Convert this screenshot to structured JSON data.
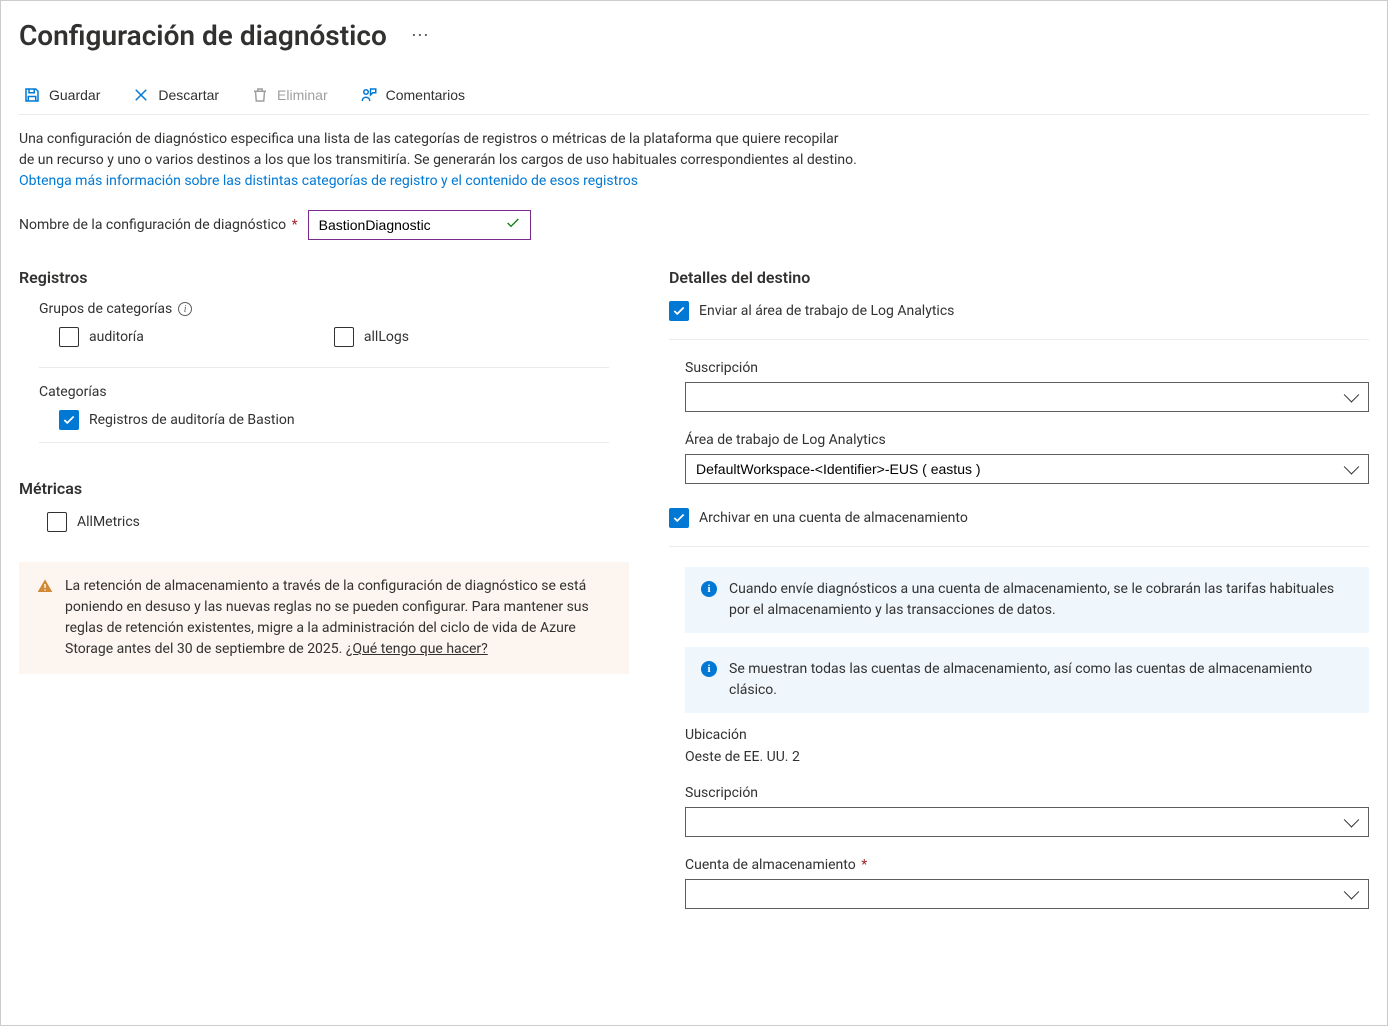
{
  "page_title": "Configuración de diagnóstico",
  "toolbar": {
    "save": "Guardar",
    "discard": "Descartar",
    "delete": "Eliminar",
    "comments": "Comentarios"
  },
  "description": {
    "line1": "Una configuración de diagnóstico especifica una lista de las categorías de registros o métricas de la plataforma que quiere recopilar",
    "line2": "de un recurso y uno o varios destinos a los que los transmitiría. Se generarán los cargos de uso habituales correspondientes al destino.",
    "link": "Obtenga más información sobre las distintas categorías de registro y el contenido de esos registros"
  },
  "name_field": {
    "label": "Nombre de la configuración de diagnóstico",
    "value": "BastionDiagnostic"
  },
  "logs": {
    "title": "Registros",
    "category_groups_title": "Grupos de categorías",
    "auditoria": "auditoría",
    "allLogs": "allLogs",
    "categories_title": "Categorías",
    "bastion_audit": "Registros de auditoría de Bastion"
  },
  "metrics": {
    "title": "Métricas",
    "allMetrics": "AllMetrics"
  },
  "warning": {
    "text": "La retención de almacenamiento a través de la configuración de diagnóstico se está poniendo en desuso y las nuevas reglas no se pueden configurar. Para mantener sus reglas de retención existentes, migre a la administración del ciclo de vida de Azure Storage antes del 30 de septiembre de 2025. ",
    "link": "¿Qué tengo que hacer?"
  },
  "destination": {
    "title": "Detalles del destino",
    "send_la": "Enviar al área de trabajo de Log Analytics",
    "subscription_label": "Suscripción",
    "workspace_label": "Área de trabajo de Log Analytics",
    "workspace_value": "DefaultWorkspace-<Identifier>-EUS ( eastus )",
    "archive_storage": "Archivar en una cuenta de almacenamiento",
    "info1": "Cuando envíe diagnósticos a una cuenta de almacenamiento, se le cobrarán las tarifas habituales por el almacenamiento y las transacciones de datos.",
    "info2": "Se muestran todas las cuentas de almacenamiento, así como las cuentas de almacenamiento clásico.",
    "location_label": "Ubicación",
    "location_value": "Oeste de EE. UU. 2",
    "storage_subscription_label": "Suscripción",
    "storage_account_label": "Cuenta de almacenamiento"
  }
}
